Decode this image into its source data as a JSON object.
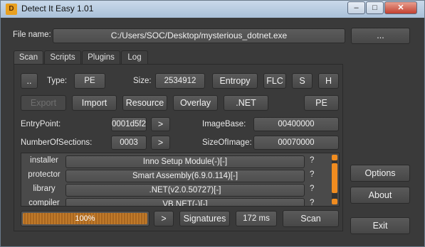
{
  "window": {
    "title": "Detect It Easy 1.01",
    "icon_label": "D"
  },
  "file": {
    "label": "File name:",
    "path": "C:/Users/SOC/Desktop/mysterious_dotnet.exe",
    "browse_label": "..."
  },
  "tabs": [
    {
      "label": "Scan"
    },
    {
      "label": "Scripts"
    },
    {
      "label": "Plugins"
    },
    {
      "label": "Log"
    }
  ],
  "scan": {
    "up_label": "..",
    "type_label": "Type:",
    "type_value": "PE",
    "size_label": "Size:",
    "size_value": "2534912",
    "buttons": {
      "entropy": "Entropy",
      "flc": "FLC",
      "s": "S",
      "h": "H",
      "export": "Export",
      "import": "Import",
      "resource": "Resource",
      "overlay": "Overlay",
      "net": ".NET",
      "pe": "PE"
    },
    "entrypoint": {
      "label": "EntryPoint:",
      "value": "0001d5f2",
      "go": ">"
    },
    "imagebase": {
      "label": "ImageBase:",
      "value": "00400000"
    },
    "sections": {
      "label": "NumberOfSections:",
      "value": "0003",
      "go": ">"
    },
    "sizeofimage": {
      "label": "SizeOfImage:",
      "value": "00070000"
    },
    "results": [
      {
        "type": "installer",
        "value": "Inno Setup Module(-)[-]",
        "q": "?"
      },
      {
        "type": "protector",
        "value": "Smart Assembly(6.9.0.114)[-]",
        "q": "?"
      },
      {
        "type": "library",
        "value": ".NET(v2.0.50727)[-]",
        "q": "?"
      },
      {
        "type": "compiler",
        "value": "VB.NET(-)[-]",
        "q": "?"
      }
    ],
    "progress": {
      "text": "100%",
      "percent": 100
    },
    "next": ">",
    "signatures_label": "Signatures",
    "time": "172 ms",
    "scan_label": "Scan"
  },
  "side": {
    "options": "Options",
    "about": "About",
    "exit": "Exit"
  }
}
